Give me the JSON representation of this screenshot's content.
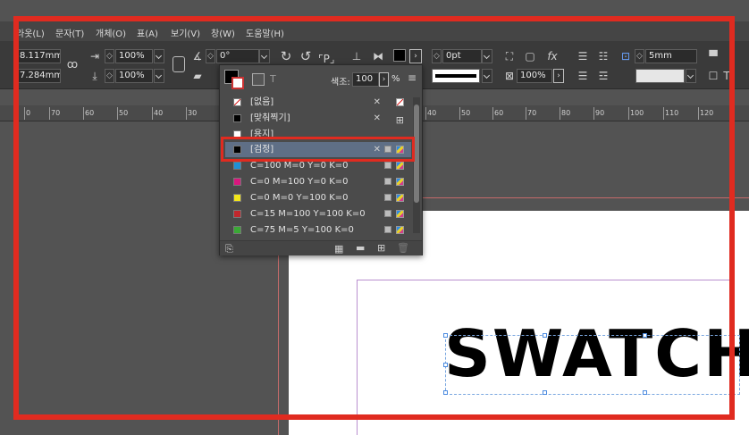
{
  "menu": [
    "창(W)",
    "문자(T)",
    "개체(O)",
    "표(A)",
    "보기(V)",
    "창(W)",
    "도움말(H)"
  ],
  "menu_first_partial": "라옷(L)",
  "control": {
    "x_value": "8.117mm",
    "y_value": "7.284mm",
    "scale_x": "100%",
    "scale_y": "100%",
    "angle": "0°",
    "stroke_weight": "0pt",
    "opacity": "100%",
    "gap": "5mm"
  },
  "ruler_ticks": [
    "0",
    "70",
    "60",
    "50",
    "40",
    "30",
    "40",
    "50",
    "60",
    "70",
    "80",
    "90",
    "100",
    "110",
    "120"
  ],
  "swatches": {
    "tint_label": "색조:",
    "tint_value": "100",
    "tint_unit": "%",
    "items": [
      {
        "name": "[없음]",
        "color": "none"
      },
      {
        "name": "[맞춰찍기]",
        "color": "#000000"
      },
      {
        "name": "[용지]",
        "color": "#ffffff"
      },
      {
        "name": "[검정]",
        "color": "#000000",
        "selected": true
      },
      {
        "name": "C=100 M=0 Y=0 K=0",
        "color": "#1e90d6"
      },
      {
        "name": "C=0 M=100 Y=0 K=0",
        "color": "#d9177e"
      },
      {
        "name": "C=0 M=0 Y=100 K=0",
        "color": "#f2e51a"
      },
      {
        "name": "C=15 M=100 Y=100 K=0",
        "color": "#c1272d"
      },
      {
        "name": "C=75 M=5 Y=100 K=0",
        "color": "#3aa935"
      }
    ]
  },
  "canvas_text": "SWATCH",
  "accent_color": "#e02b20"
}
